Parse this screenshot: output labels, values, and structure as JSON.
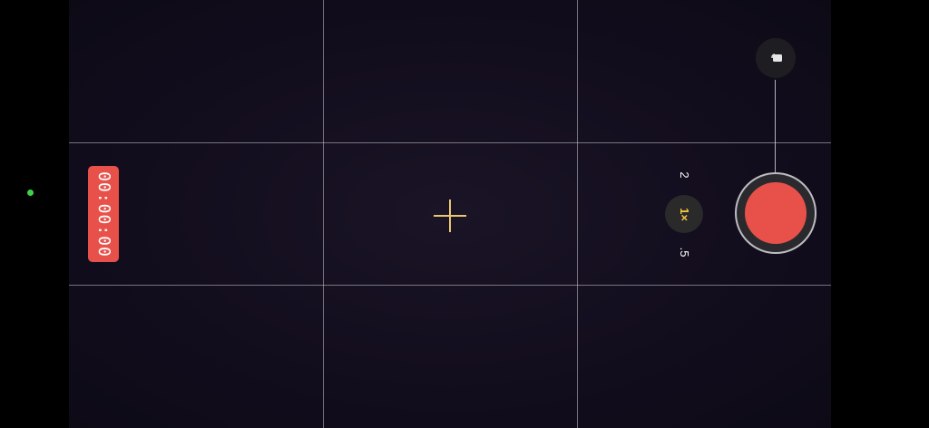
{
  "recording": {
    "timer": "00:00:00",
    "badge_color": "#e8514a"
  },
  "indicators": {
    "status_dot_color": "#3fd14a"
  },
  "zoom": {
    "options": [
      "2",
      "1×",
      ".5"
    ],
    "selected": "1×",
    "selected_color": "#f5c542"
  },
  "focus": {
    "crosshair_color": "#e8c872"
  },
  "controls": {
    "lock_icon": "lock-icon",
    "shutter_color": "#e8514a"
  }
}
